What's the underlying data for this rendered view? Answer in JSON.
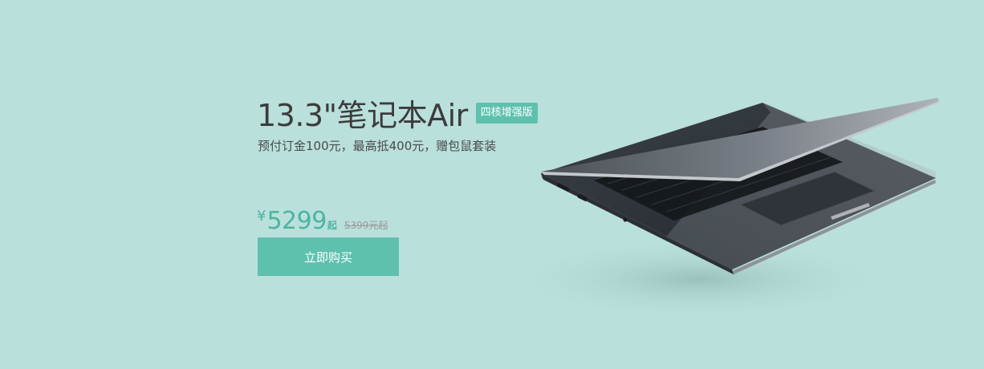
{
  "product": {
    "title": "13.3\"笔记本Air",
    "badge": "四核增强版",
    "subtitle": "预付订金100元，最高抵400元，赠包鼠套装"
  },
  "pricing": {
    "currency_symbol": "¥",
    "price": "5299",
    "price_suffix": "起",
    "original_price": "5399元起"
  },
  "cta": {
    "buy_label": "立即购买"
  },
  "colors": {
    "background": "#bae0dc",
    "accent": "#5ec1ad",
    "price": "#4cb5a0"
  },
  "image": {
    "icon": "laptop-image"
  }
}
